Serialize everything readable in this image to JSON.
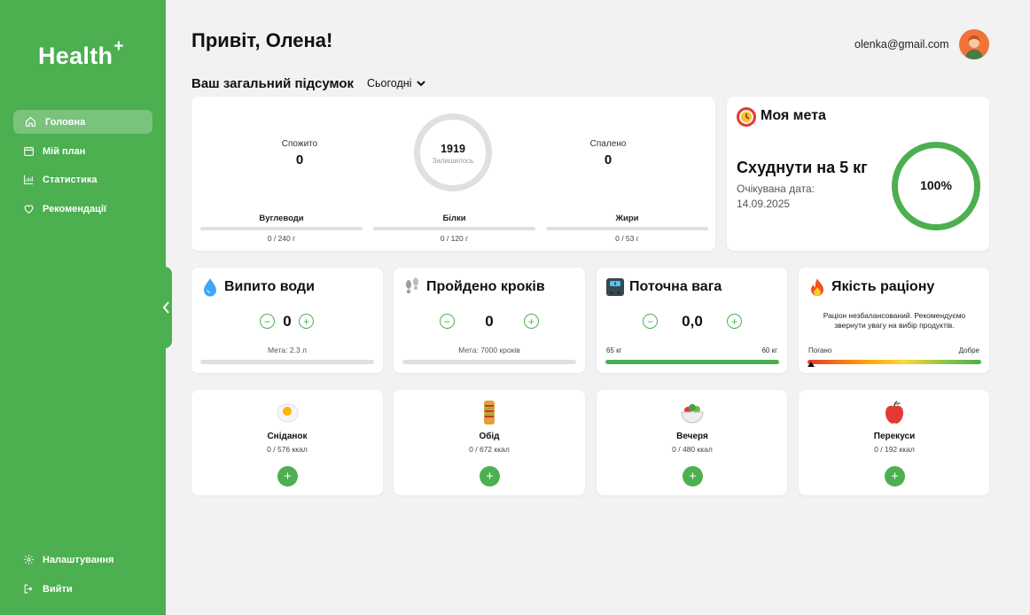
{
  "app": {
    "logo": "Health",
    "logo_mark": "+"
  },
  "sidebar": {
    "items": [
      {
        "label": "Головна",
        "icon": "home-icon",
        "active": true
      },
      {
        "label": "Мій план",
        "icon": "calendar-icon"
      },
      {
        "label": "Статистика",
        "icon": "chart-icon"
      },
      {
        "label": "Рекомендації",
        "icon": "heart-icon"
      }
    ],
    "bottom": [
      {
        "label": "Налаштування",
        "icon": "gear-icon"
      },
      {
        "label": "Вийти",
        "icon": "logout-icon"
      }
    ]
  },
  "header": {
    "greeting": "Привіт, Олена!",
    "email": "olenka@gmail.com"
  },
  "summary": {
    "title": "Ваш загальний підсумок",
    "period": "Сьогодні",
    "consumed_label": "Спожито",
    "consumed_value": "0",
    "remaining_value": "1919",
    "remaining_label": "Залишилось",
    "burned_label": "Спалено",
    "burned_value": "0",
    "macros": [
      {
        "label": "Вуглеводи",
        "value": "0 / 240 г",
        "fraction": 0
      },
      {
        "label": "Білки",
        "value": "0 / 120 г",
        "fraction": 0
      },
      {
        "label": "Жири",
        "value": "0 / 53 г",
        "fraction": 0
      }
    ]
  },
  "goal": {
    "title": "Моя мета",
    "text": "Схуднути на 5 кг",
    "date_label": "Очікувана дата:",
    "date": "14.09.2025",
    "percent": "100%",
    "progress_fraction": 1.0
  },
  "water": {
    "title": "Випито води",
    "value": "0",
    "meta": "Мета: 2.3 л",
    "minus": "−",
    "plus": "+",
    "fraction": 0
  },
  "steps": {
    "title": "Пройдено кроків",
    "value": "0",
    "meta": "Мета: 7000 кроків",
    "minus": "−",
    "plus": "+",
    "fraction": 0
  },
  "weight": {
    "title": "Поточна вага",
    "value": "0,0",
    "start": "65 кг",
    "target": "60 кг",
    "minus": "−",
    "plus": "+",
    "fraction": 1.0
  },
  "diet": {
    "title": "Якість раціону",
    "note": "Раціон незбалансований. Рекомендуємо звернути увагу на вибір продуктів.",
    "bad": "Погано",
    "good": "Добре",
    "fraction": 0
  },
  "meals": [
    {
      "name": "Сніданок",
      "kcal": "0 / 576 ккал",
      "icon": "egg-icon",
      "add": "+"
    },
    {
      "name": "Обід",
      "kcal": "0 / 672 ккал",
      "icon": "wrap-icon",
      "add": "+"
    },
    {
      "name": "Вечеря",
      "kcal": "0 / 480 ккал",
      "icon": "salad-icon",
      "add": "+"
    },
    {
      "name": "Перекуси",
      "kcal": "0 / 192 ккал",
      "icon": "apple-icon",
      "add": "+"
    }
  ],
  "colors": {
    "accent": "#4caf50",
    "background": "#f2f2f2",
    "avatar": "#f0743a"
  }
}
